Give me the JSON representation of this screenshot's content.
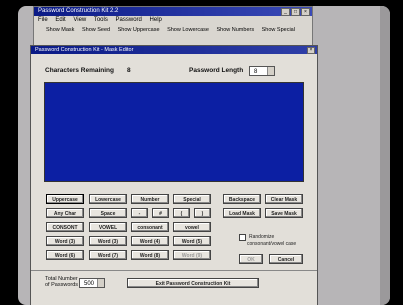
{
  "app": {
    "main_title": "Password Construction Kit 2.2",
    "menu": [
      "File",
      "Edit",
      "View",
      "Tools",
      "Password",
      "Help"
    ],
    "toolbar": [
      "Show Mask",
      "Show Seed",
      "Show Uppercase",
      "Show Lowercase",
      "Show Numbers",
      "Show Special"
    ]
  },
  "editor": {
    "title": "Password Construction Kit - Mask Editor",
    "characters_remaining_label": "Characters Remaining",
    "characters_remaining_value": "8",
    "password_length_label": "Password Length",
    "password_length_value": "8",
    "buttons": {
      "uppercase": "Uppercase",
      "lowercase": "Lowercase",
      "number": "Number",
      "special": "Special",
      "any_char": "Any Char",
      "space": "Space",
      "dash": "-",
      "hash": "#",
      "open_bracket": "(",
      "close_bracket": ")",
      "consont": "CONSONT",
      "vowel_upper": "VOWEL",
      "consonant": "consonant",
      "vowel": "vowel",
      "word3_a": "Word (3)",
      "word3_b": "Word (3)",
      "word4": "Word (4)",
      "word5": "Word (5)",
      "word6": "Word (6)",
      "word7": "Word (7)",
      "word8": "Word (8)",
      "word9": "Word (9)",
      "backspace": "Backspace",
      "clear_mask": "Clear Mask",
      "load_mask": "Load Mask",
      "save_mask": "Save Mask",
      "ok": "OK",
      "cancel": "Cancel"
    },
    "randomize_label_line1": "Randomize",
    "randomize_label_line2": "consonant/vowel case",
    "total_number_label_line1": "Total Number",
    "total_number_label_line2": "of Passwords",
    "total_number_value": "500",
    "exit_label": "Exit Password Construction Kit"
  }
}
